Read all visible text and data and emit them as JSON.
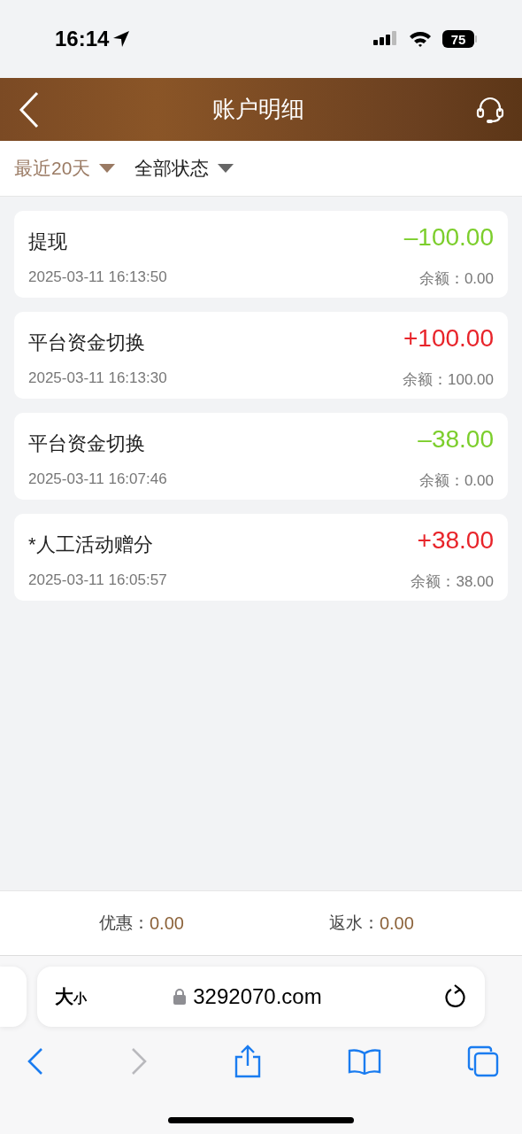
{
  "status_bar": {
    "time": "16:14",
    "battery": "75"
  },
  "header": {
    "title": "账户明细"
  },
  "filters": [
    {
      "label": "最近20天",
      "selected": true
    },
    {
      "label": "全部状态",
      "selected": false
    }
  ],
  "transactions": [
    {
      "title": "提现",
      "time": "2025-03-11 16:13:50",
      "amount": "–100.00",
      "kind": "debit",
      "balance": "余额：0.00"
    },
    {
      "title": "平台资金切换",
      "time": "2025-03-11 16:13:30",
      "amount": "+100.00",
      "kind": "credit",
      "balance": "余额：100.00"
    },
    {
      "title": "平台资金切换",
      "time": "2025-03-11 16:07:46",
      "amount": "–38.00",
      "kind": "debit",
      "balance": "余额：0.00"
    },
    {
      "title": "*人工活动赠分",
      "time": "2025-03-11 16:05:57",
      "amount": "+38.00",
      "kind": "credit",
      "balance": "余额：38.00"
    }
  ],
  "summary": [
    {
      "label": "优惠：",
      "value": "0.00"
    },
    {
      "label": "返水：",
      "value": "0.00"
    }
  ],
  "browser": {
    "text_size": {
      "large": "大",
      "small": "小"
    },
    "url": "3292070.com"
  }
}
